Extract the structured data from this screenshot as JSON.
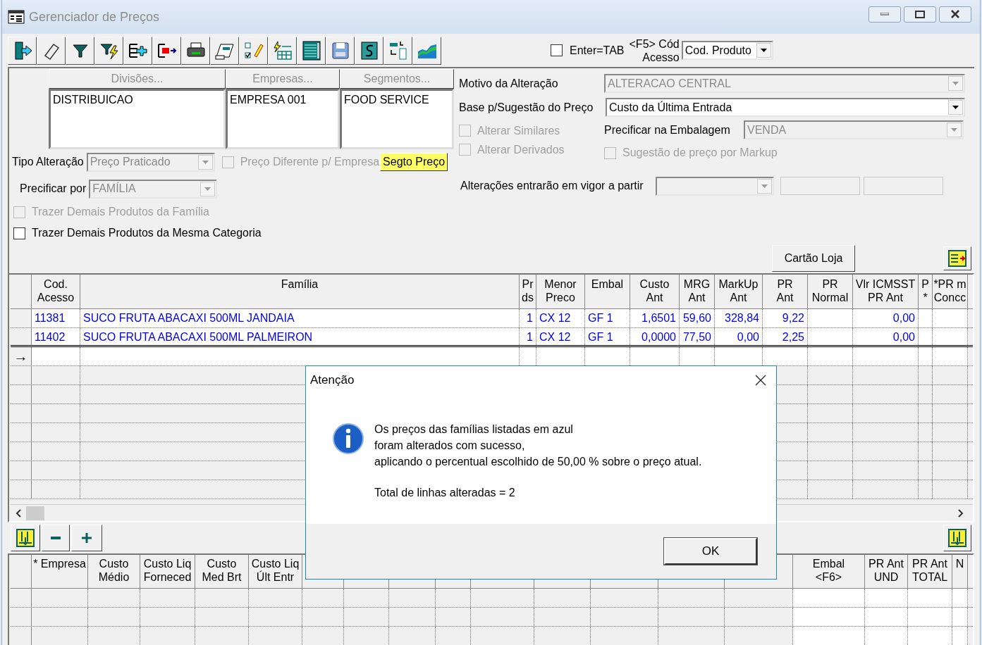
{
  "window": {
    "title": "Gerenciador de Preços"
  },
  "toolbar": [
    {
      "kind": "exit"
    },
    {
      "kind": "eraser"
    },
    {
      "kind": "filter"
    },
    {
      "kind": "filter_bolt"
    },
    {
      "kind": "add_rows"
    },
    {
      "kind": "remove_rows"
    },
    {
      "kind": "printer"
    },
    {
      "kind": "form"
    },
    {
      "kind": "checklist"
    },
    {
      "kind": "columns"
    },
    {
      "kind": "table"
    },
    {
      "kind": "save"
    },
    {
      "kind": "refresh"
    },
    {
      "kind": "swap"
    },
    {
      "kind": "chart"
    }
  ],
  "enter_tab": {
    "label": "Enter=TAB",
    "checked": false
  },
  "access_code": {
    "label_lines": [
      "<F5> Cód",
      "Acesso"
    ],
    "value": "Cod. Produto"
  },
  "lists": [
    {
      "header": "Divisões...",
      "items": [
        "DISTRIBUICAO"
      ]
    },
    {
      "header": "Empresas...",
      "items": [
        "EMPRESA 001"
      ]
    },
    {
      "header": "Segmentos...",
      "items": [
        "FOOD SERVICE"
      ]
    }
  ],
  "tipo_alteracao": {
    "label": "Tipo Alteração",
    "value": "Preço Praticado",
    "disabled": true
  },
  "preco_diferente": {
    "label": "Preço Diferente p/ Empresa",
    "checked": false,
    "disabled": true
  },
  "segto_preco": "Segto Preço",
  "precificar_por": {
    "label": "Precificar por",
    "value": "FAMÍLIA",
    "disabled": true
  },
  "bring_options": [
    {
      "label": "Trazer Demais Produtos da Família",
      "checked": false,
      "disabled": true
    },
    {
      "label": "Trazer Demais Produtos da Mesma Categoria",
      "checked": false,
      "disabled": false
    }
  ],
  "motivo": {
    "label": "Motivo da Alteração",
    "value": "ALTERACAO CENTRAL",
    "disabled": true
  },
  "base": {
    "label": "Base p/Sugestão do Preço",
    "value": "Custo da Última Entrada",
    "disabled": false
  },
  "alterar": [
    {
      "label": "Alterar Similares",
      "checked": false,
      "disabled": true
    },
    {
      "label": "Alterar Derivados",
      "checked": false,
      "disabled": true
    }
  ],
  "embalagem": {
    "label": "Precificar na Embalagem",
    "value": "VENDA",
    "disabled": true
  },
  "markup": {
    "label": "Sugestão de preço por Markup",
    "checked": false,
    "disabled": true
  },
  "vigor": {
    "label": "Alterações entrarão em vigor a partir",
    "disabled": true
  },
  "cartao_loja": "Cartão Loja",
  "grid": {
    "columns": [
      "Cod.\nAcesso",
      "Família",
      "Pr\nds",
      "Menor\nPreco",
      "Embal",
      "Custo\nAnt",
      "MRG\nAnt",
      "MarkUp\nAnt",
      "PR\nAnt",
      "PR\nNormal",
      "Vlr ICMSST\nPR Ant",
      "P\n*",
      "*PR m\nConcc"
    ],
    "current_marker": "→",
    "rows": [
      {
        "changed": true,
        "current": false,
        "cells": [
          "11381",
          "SUCO FRUTA ABACAXI 500ML JANDAIA",
          "1",
          "CX 12",
          "GF 1",
          "1,6501",
          "59,60",
          "328,84",
          "9,22",
          "",
          "0,00",
          "",
          ""
        ]
      },
      {
        "changed": true,
        "current": false,
        "cells": [
          "11402",
          "SUCO FRUTA ABACAXI 500ML PALMEIRON",
          "1",
          "CX 12",
          "GF 1",
          "0,0000",
          "77,50",
          "0,00",
          "2,25",
          "",
          "0,00",
          "",
          ""
        ]
      },
      {
        "changed": false,
        "current": true,
        "cells": [
          "",
          "",
          "",
          "",
          "",
          "",
          "",
          "",
          "",
          "",
          "",
          "",
          ""
        ]
      }
    ]
  },
  "lower_grid": {
    "columns": [
      {
        "label": "* Empresa",
        "editable": false
      },
      {
        "label": "Custo\nMédio",
        "editable": false
      },
      {
        "label": "Custo Liq\nForneced",
        "editable": false
      },
      {
        "label": "Custo\nMed Brt",
        "editable": false
      },
      {
        "label": "Custo Liq\nÚlt Entr",
        "editable": false
      },
      {
        "editable": false
      },
      {
        "editable": false
      },
      {
        "editable": false
      },
      {
        "editable": false
      },
      {
        "editable": false
      },
      {
        "editable": false
      },
      {
        "editable": false
      },
      {
        "editable": false
      },
      {
        "editable": false
      },
      {
        "label": "Embal\n<F6>",
        "editable": true
      },
      {
        "label": "PR Ant\nUND",
        "editable": true
      },
      {
        "label": "PR Ant\nTOTAL",
        "editable": true
      },
      {
        "label": "N",
        "editable": true
      }
    ]
  },
  "dialog": {
    "title": "Atenção",
    "message": "Os preços das famílias listadas em azul\nforam alterados com sucesso,\naplicando o percentual escolhido de 50,00 % sobre o preço atual.",
    "summary": "Total de linhas alteradas = 2",
    "button": "OK"
  }
}
